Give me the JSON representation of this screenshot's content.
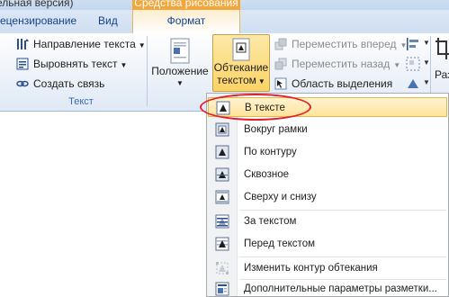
{
  "window": {
    "title_fragment": "ельная версия)",
    "context_header": "Средства рисования"
  },
  "tabs": [
    {
      "label": "ецензирование"
    },
    {
      "label": "Вид"
    },
    {
      "label": "Формат"
    }
  ],
  "ribbon": {
    "text_group": {
      "items": [
        {
          "label": "Направление текста",
          "icon": "text-direction-icon"
        },
        {
          "label": "Выровнять текст",
          "icon": "align-text-icon"
        },
        {
          "label": "Создать связь",
          "icon": "link-icon"
        }
      ],
      "label": "Текст"
    },
    "arrange": {
      "position_label_1": "Положение",
      "wrap_label_1": "Обтекание",
      "wrap_label_2": "текстом",
      "bring_forward": "Переместить вперед",
      "send_backward": "Переместить назад",
      "selection_pane": "Область выделения",
      "cut_label": "Раз"
    }
  },
  "menu": {
    "items": [
      {
        "label": "В тексте",
        "icon": "inline-with-text-icon",
        "enabled": true,
        "active": true
      },
      {
        "label": "Вокруг рамки",
        "icon": "square-wrap-icon",
        "enabled": true
      },
      {
        "label": "По контуру",
        "icon": "tight-wrap-icon",
        "enabled": true
      },
      {
        "label": "Сквозное",
        "icon": "through-wrap-icon",
        "enabled": true
      },
      {
        "label": "Сверху и снизу",
        "icon": "top-bottom-wrap-icon",
        "enabled": true
      },
      {
        "label": "За текстом",
        "icon": "behind-text-icon",
        "enabled": true
      },
      {
        "label": "Перед текстом",
        "icon": "in-front-of-text-icon",
        "enabled": true
      },
      {
        "label": "Изменить контур обтекания",
        "icon": "edit-wrap-points-icon",
        "enabled": false
      },
      {
        "label": "Дополнительные параметры разметки...",
        "icon": "more-layout-options-icon",
        "enabled": true
      }
    ]
  },
  "colors": {
    "accent": "#f3a63b",
    "highlight_oval": "#e0202a",
    "ribbon_text": "#15428b"
  }
}
